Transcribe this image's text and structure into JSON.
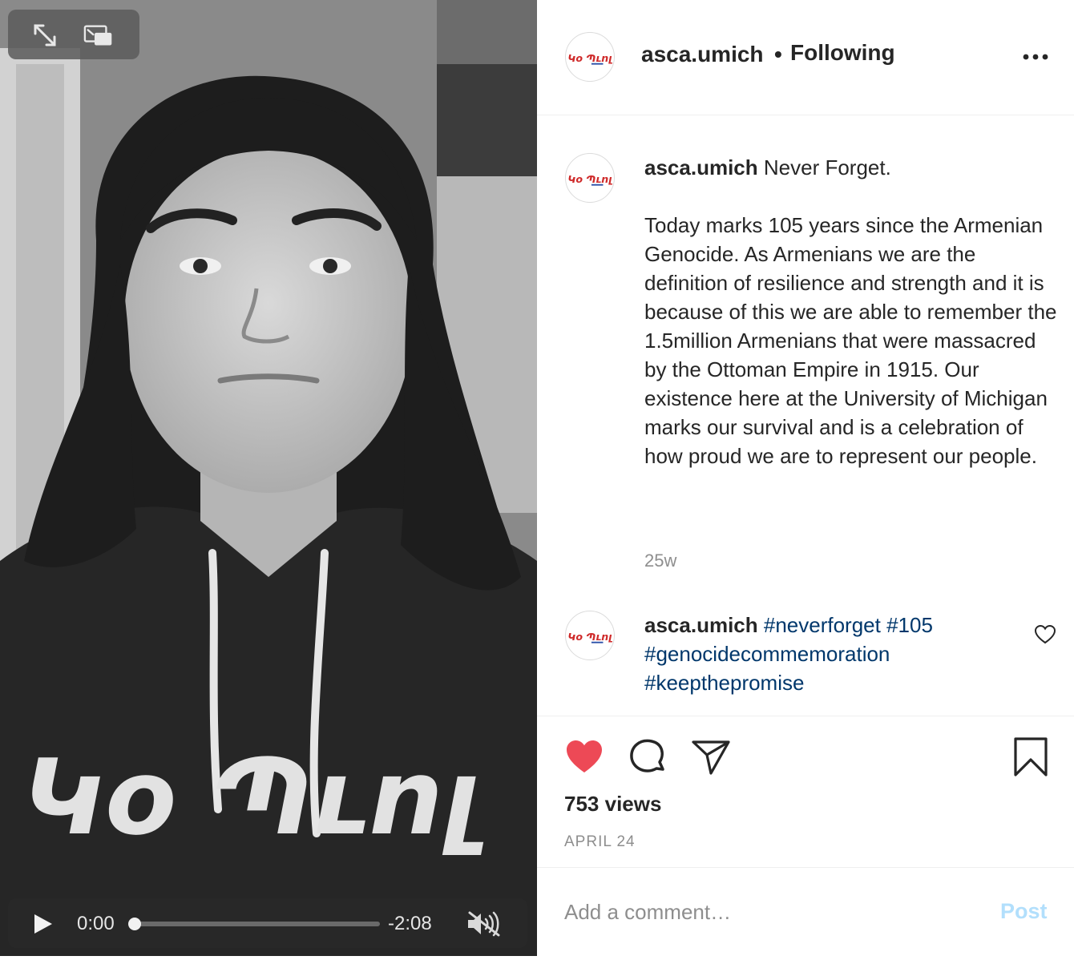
{
  "video": {
    "current_time": "0:00",
    "remaining_time": "-2:08",
    "progress": 0.0,
    "controls": {
      "expand_icon": "expand-arrows-icon",
      "pip_icon": "picture-in-picture-icon",
      "play_icon": "play-icon",
      "mute_icon": "speaker-muted-icon"
    }
  },
  "header": {
    "username": "asca.umich",
    "separator": "•",
    "follow_status": "Following",
    "more_icon": "more-horizontal-icon"
  },
  "avatar_logo_text": "Կօ Պւոլ",
  "caption": {
    "username": "asca.umich",
    "headline": "Never Forget.",
    "body": "Today marks 105 years since the Armenian Genocide. As Armenians we are the definition of resilience and strength and it is because of this we are able to remember the 1.5million Armenians that were massacred by the Ottoman Empire in 1915. Our existence here at the University of Michigan marks our survival and is a celebration of how proud we are to represent our people.",
    "time_ago": "25w"
  },
  "comment": {
    "username": "asca.umich",
    "tags": [
      "#neverforget",
      "#105",
      "#genocidecommemoration",
      "#keepthepromise"
    ]
  },
  "actions": {
    "like_icon": "heart-filled-icon",
    "comment_icon": "comment-bubble-icon",
    "share_icon": "paper-plane-icon",
    "save_icon": "bookmark-icon",
    "like_color": "#ed4956",
    "views": "753 views",
    "date": "APRIL 24"
  },
  "add_comment": {
    "placeholder": "Add a comment…",
    "post_label": "Post",
    "post_color": "#b2dffc"
  },
  "colors": {
    "text_primary": "#262626",
    "text_secondary": "#8e8e8e",
    "hashtag": "#00376b",
    "divider": "#efefef"
  }
}
